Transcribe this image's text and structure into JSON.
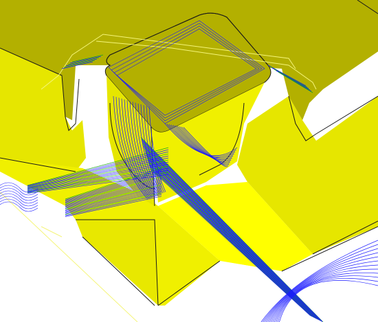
{
  "scene": {
    "subject": "cam-toolpath-on-block",
    "colors": {
      "top_face": "#b3b000",
      "top_face_shadow": "#a8a500",
      "front_face": "#e6e600",
      "side_face": "#f0f000",
      "bright_face": "#ffff00",
      "edge": "#1a1a1a",
      "toolpath_blue": "#1a1aff",
      "toolpath_green": "#1aa51a",
      "rapid_move": "#f5f57a",
      "background": "#ffffff"
    }
  }
}
